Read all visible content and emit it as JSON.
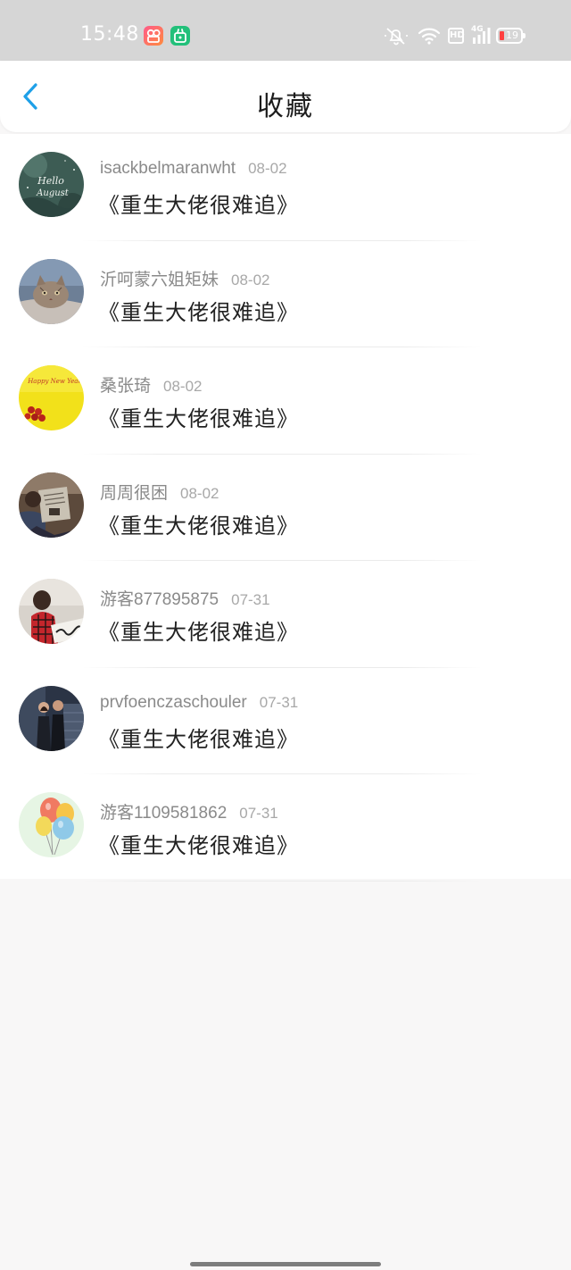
{
  "status_bar": {
    "time": "15:48",
    "app_icons": [
      "video-app-icon",
      "shop-app-icon"
    ],
    "indicators": [
      "mute-bell-icon",
      "wifi-icon",
      "hd-icon",
      "signal-icon",
      "battery-icon"
    ],
    "hd_label": "HD",
    "network_label": "4G",
    "battery_level": "19",
    "battery_color": "#ff4040"
  },
  "header": {
    "title": "收藏",
    "back_icon": "chevron-left-icon",
    "accent_color": "#1ea0e8"
  },
  "favorites": [
    {
      "user": "isackbelmaranwht",
      "date": "08-02",
      "title": "《重生大佬很难追》"
    },
    {
      "user": "沂呵蒙六姐矩妹",
      "date": "08-02",
      "title": "《重生大佬很难追》"
    },
    {
      "user": "桑张琦",
      "date": "08-02",
      "title": "《重生大佬很难追》"
    },
    {
      "user": "周周很困",
      "date": "08-02",
      "title": "《重生大佬很难追》"
    },
    {
      "user": "游客877895875",
      "date": "07-31",
      "title": "《重生大佬很难追》"
    },
    {
      "user": "prvfoenczaschouler",
      "date": "07-31",
      "title": "《重生大佬很难追》"
    },
    {
      "user": "游客1109581862",
      "date": "07-31",
      "title": "《重生大佬很难追》"
    }
  ],
  "avatar_text": {
    "hello_august_1": "Hello",
    "hello_august_2": "August",
    "happy_new_year": "Happy New Year"
  }
}
